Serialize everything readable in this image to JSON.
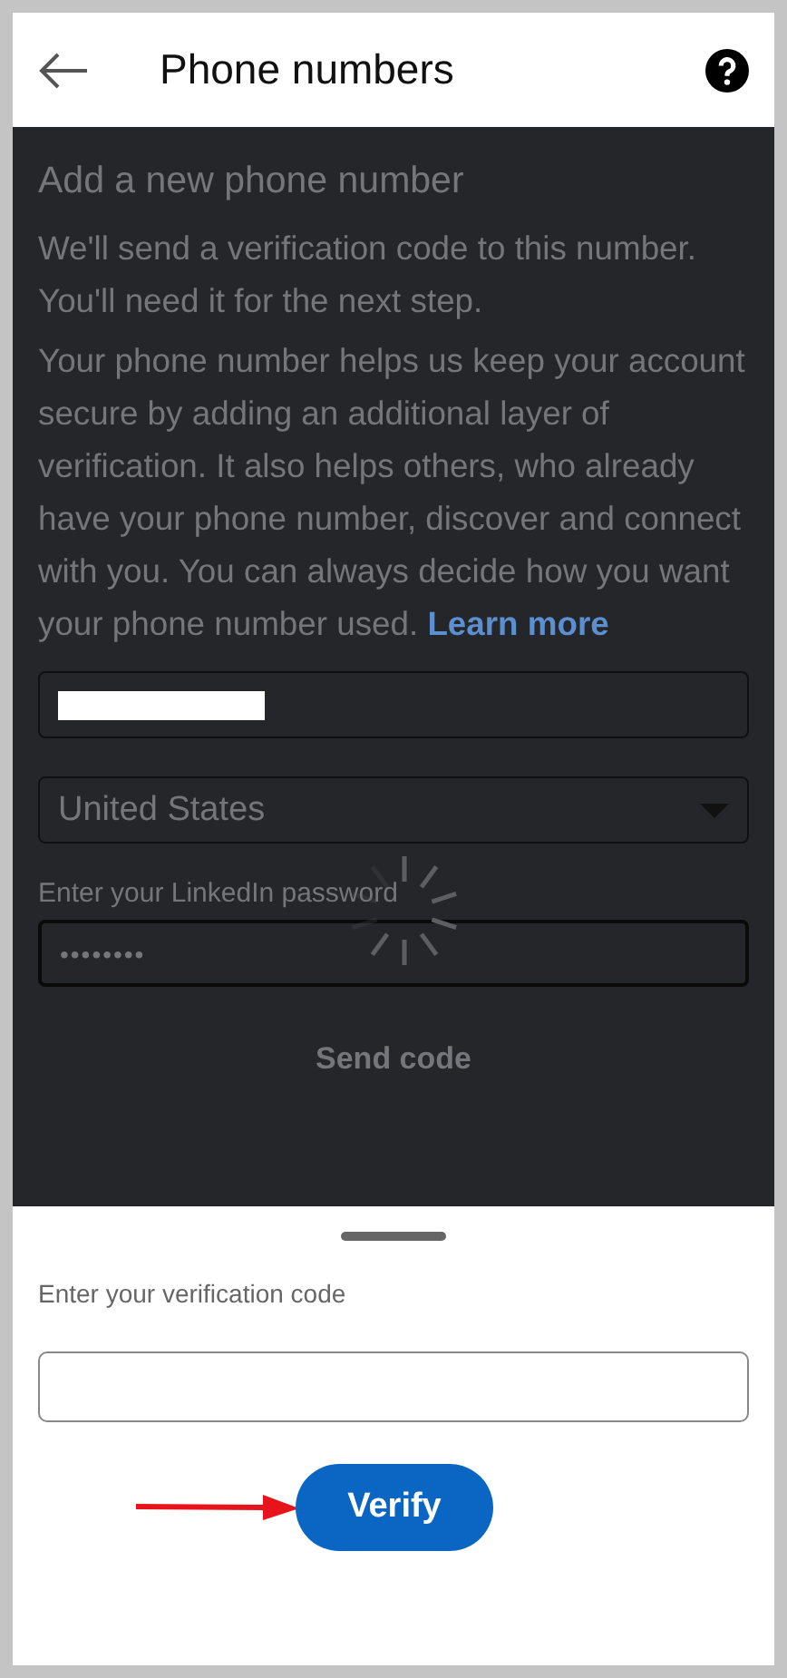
{
  "header": {
    "title": "Phone numbers"
  },
  "form": {
    "heading": "Add a new phone number",
    "intro": "We'll send a verification code to this number. You'll need it for the next step.",
    "description": "Your phone number helps us keep your account secure by adding an additional layer of verification. It also helps others, who already have your phone number, discover and connect with you. You can always decide how you want your phone number used.",
    "learn_more": "Learn more",
    "country": "United States",
    "password_label": "Enter your LinkedIn password",
    "password_value": "••••••••",
    "send_button": "Send code",
    "loading": true
  },
  "sheet": {
    "code_label": "Enter your verification code",
    "verify_button": "Verify"
  }
}
